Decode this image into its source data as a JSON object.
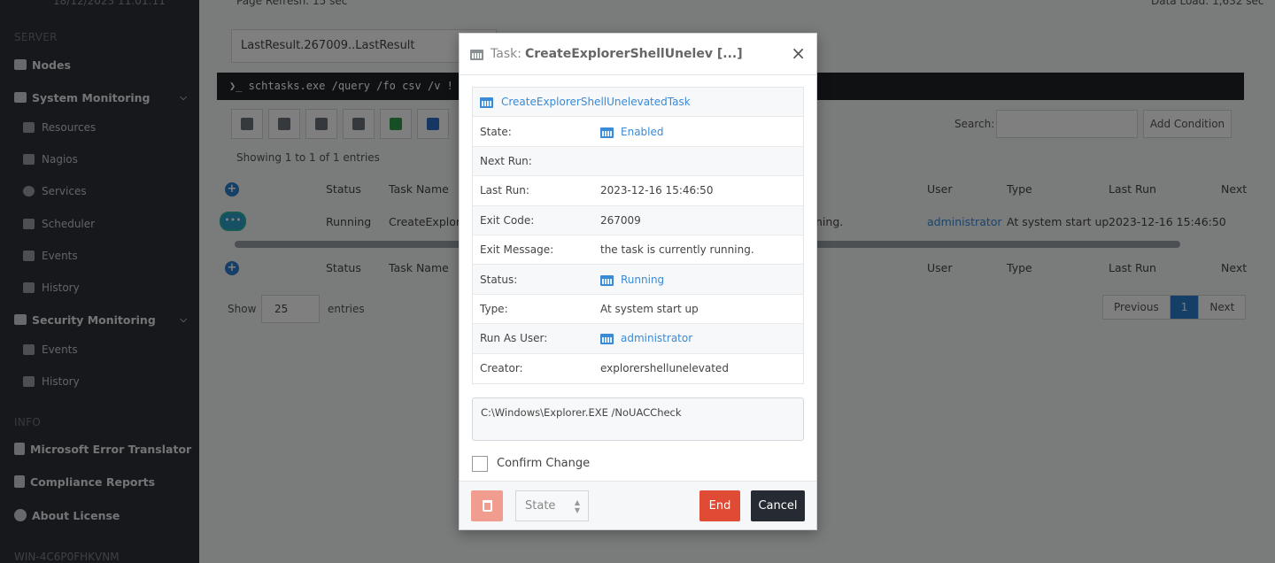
{
  "sidebar": {
    "timestamp": "18/12/2023 11:01:11",
    "server_heading": "SERVER",
    "nodes": "Nodes",
    "system_monitoring": "System Monitoring",
    "system_sub": [
      "Resources",
      "Nagios",
      "Services",
      "Scheduler",
      "Events",
      "History"
    ],
    "security_monitoring": "Security Monitoring",
    "security_sub": [
      "Events",
      "History"
    ],
    "info_heading": "INFO",
    "info_items": [
      "Microsoft Error Translator",
      "Compliance Reports",
      "About License"
    ],
    "host": "WIN-4C6P0FHKVNM"
  },
  "main": {
    "page_refresh": "Page Refresh: 15 sec",
    "data_load": "Data Load: 1,632 sec",
    "filter": "LastResult.267009..LastResult",
    "command": "❯_ schtasks.exe /query /fo csv /v !",
    "search_label": "Search:",
    "add_condition": "Add Condition",
    "showing": "Showing 1 to 1 of 1 entries",
    "headers": {
      "status": "Status",
      "task_name": "Task Name",
      "user": "User",
      "type": "Type",
      "last_run": "Last Run",
      "next": "Next"
    },
    "row": {
      "status": "Running",
      "task_name": "CreateExplore",
      "msg_tail": "ning.",
      "user": "administrator",
      "type": "At system start up",
      "last_run": "2023-12-16 15:46:50"
    },
    "show_label": "Show",
    "show_value": "25",
    "entries_label": "entries",
    "pager": {
      "previous": "Previous",
      "page": "1",
      "next": "Next"
    }
  },
  "modal": {
    "title_prefix": "Task:",
    "title": "CreateExplorerShellUnelev [...]",
    "task_name": "CreateExplorerShellUnelevatedTask",
    "rows": [
      {
        "label": "State:",
        "value": "Enabled"
      },
      {
        "label": "Next Run:",
        "value": ""
      },
      {
        "label": "Last Run:",
        "value": "2023-12-16 15:46:50"
      },
      {
        "label": "Exit Code:",
        "value": "267009"
      },
      {
        "label": "Exit Message:",
        "value": "the task is currently running."
      },
      {
        "label": "Status:",
        "value": "Running"
      },
      {
        "label": "Type:",
        "value": "At system start up"
      },
      {
        "label": "Run As User:",
        "value": "administrator"
      },
      {
        "label": "Creator:",
        "value": "explorershellunelevated"
      }
    ],
    "command": "C:\\Windows\\Explorer.EXE /NoUACCheck",
    "confirm_label": "Confirm Change",
    "state_placeholder": "State",
    "end_label": "End",
    "cancel_label": "Cancel"
  },
  "colors": {
    "accent": "#3a8ad6",
    "danger": "#e04b35",
    "dark": "#262b33",
    "sidebar": "#2d3136"
  }
}
